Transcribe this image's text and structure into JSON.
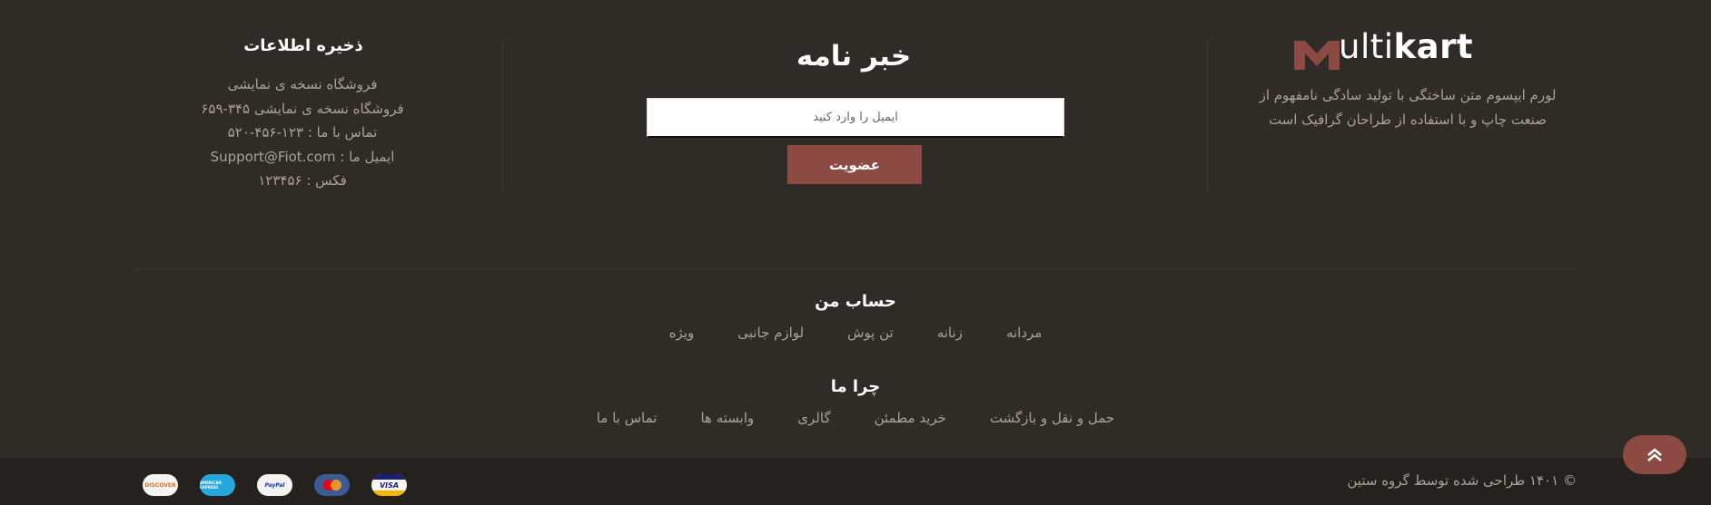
{
  "logo": {
    "prefix": "ulti",
    "bold": "kart",
    "brand_color": "#8d4a42"
  },
  "about": {
    "text": "لورم ایپسوم متن ساختگی با تولید سادگی نامفهوم از صنعت چاپ و با استفاده از طراحان گرافیک است"
  },
  "newsletter": {
    "title": "خبر نامه",
    "email_placeholder": "ایمیل را وارد کنید",
    "subscribe_label": "عضویت"
  },
  "store_info": {
    "title": "ذخیره اطلاعات",
    "lines": [
      "فروشگاه نسخه ی نمایشی",
      "فروشگاه نسخه ی نمایشی ۳۴۵-۶۵۹",
      "تماس با ما : ۱۲۳-۴۵۶-۵۲۰",
      "ایمیل ما : Support@Fiot.com",
      "فکس : ۱۲۳۴۵۶"
    ]
  },
  "my_account": {
    "title": "حساب من",
    "links": [
      "مردانه",
      "زنانه",
      "تن پوش",
      "لوازم جانبی",
      "ویژه"
    ]
  },
  "why_us": {
    "title": "چرا ما",
    "links": [
      "حمل و نقل و بازگشت",
      "خرید مطمئن",
      "گالری",
      "وابسته ها",
      "تماس با ما"
    ]
  },
  "bottom": {
    "copyright": "© ۱۴۰۱ طراحی شده توسط گروه ستین",
    "payments": [
      {
        "name": "discover-icon",
        "label": "DISCOVER"
      },
      {
        "name": "amex-icon",
        "label": "AMERICAN EXPRESS"
      },
      {
        "name": "paypal-icon",
        "label": "PayPal"
      },
      {
        "name": "mastercard-icon",
        "label": "MasterCard"
      },
      {
        "name": "visa-icon",
        "label": "VISA"
      }
    ]
  }
}
